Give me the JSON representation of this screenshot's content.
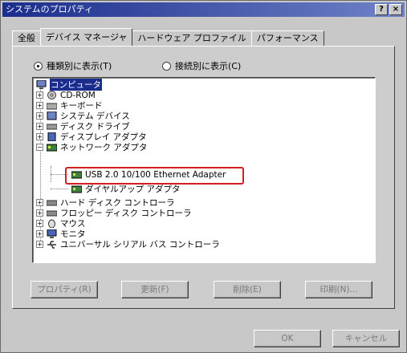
{
  "window": {
    "title": "システムのプロパティ",
    "help_glyph": "?",
    "close_glyph": "×"
  },
  "tabs": [
    {
      "label": "全般"
    },
    {
      "label": "デバイス マネージャ"
    },
    {
      "label": "ハードウェア プロファイル"
    },
    {
      "label": "パフォーマンス"
    }
  ],
  "view_options": {
    "by_type": "種類別に表示(T)",
    "by_connection": "接続別に表示(C)",
    "selected": "by_type"
  },
  "tree": {
    "root": "コンピュータ",
    "items": [
      {
        "label": "CD-ROM",
        "icon": "cdrom-icon"
      },
      {
        "label": "キーボード",
        "icon": "keyboard-icon"
      },
      {
        "label": "システム デバイス",
        "icon": "system-device-icon"
      },
      {
        "label": "ディスク ドライブ",
        "icon": "disk-drive-icon"
      },
      {
        "label": "ディスプレイ アダプタ",
        "icon": "display-adapter-icon"
      },
      {
        "label": "ネットワーク アダプタ",
        "icon": "network-adapter-icon",
        "expanded": true,
        "children": [
          {
            "label": "USB 2.0 10/100 Ethernet Adapter",
            "icon": "ethernet-adapter-icon",
            "highlighted": true
          },
          {
            "label": "ダイヤルアップ アダプタ",
            "icon": "dialup-adapter-icon"
          }
        ]
      },
      {
        "label": "ハード ディスク コントローラ",
        "icon": "hdd-controller-icon"
      },
      {
        "label": "フロッピー ディスク コントローラ",
        "icon": "floppy-controller-icon"
      },
      {
        "label": "マウス",
        "icon": "mouse-icon"
      },
      {
        "label": "モニタ",
        "icon": "monitor-icon"
      },
      {
        "label": "ユニバーサル シリアル バス コントローラ",
        "icon": "usb-controller-icon"
      }
    ]
  },
  "buttons": {
    "properties": "プロパティ(R)",
    "refresh": "更新(F)",
    "remove": "削除(E)",
    "print": "印刷(N)..."
  },
  "dialog_buttons": {
    "ok": "OK",
    "cancel": "キャンセル"
  },
  "colors": {
    "highlight_border": "#d21f1f",
    "selection": "#1a2d8c"
  }
}
